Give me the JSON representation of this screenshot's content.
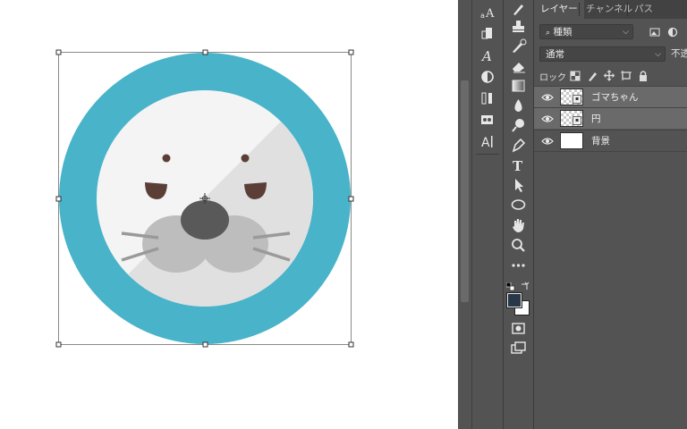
{
  "panel_tabs": [
    "レイヤー",
    "チャンネル",
    "パス"
  ],
  "filter": {
    "label": "種類"
  },
  "blend_mode": {
    "value": "通常"
  },
  "opacity": {
    "label": "不透"
  },
  "lock": {
    "label": "ロック :"
  },
  "layers": [
    {
      "name": "ゴマちゃん",
      "selected": true,
      "thumb": "transparent",
      "smart_object": true
    },
    {
      "name": "円",
      "selected": true,
      "thumb": "transparent",
      "smart_object": true
    },
    {
      "name": "背景",
      "selected": false,
      "thumb": "white",
      "smart_object": false
    }
  ],
  "colors": {
    "ring": "#48b3c9",
    "face": "#f4f4f4",
    "face_shadow": "#e0e0e0",
    "muzzle": "#bdbdbd",
    "nose": "#595959",
    "eyes": "#5b3f37",
    "whisker": "#9a9a9a",
    "foreground": "#283848",
    "background_swatch": "#ffffff"
  },
  "icons": {
    "secondary_panel": [
      "character-style-icon",
      "paragraph-icon",
      "character-icon",
      "adjustments-icon",
      "history-icon",
      "3d-icon",
      "glyphs-icon"
    ],
    "tools": [
      "brush-icon",
      "stamp-icon",
      "history-brush-icon",
      "eraser-icon",
      "gradient-icon",
      "blur-icon",
      "dodge-icon",
      "pen-icon",
      "type-icon",
      "path-select-icon",
      "ellipse-icon",
      "hand-icon",
      "zoom-icon",
      "more-tools-icon"
    ]
  }
}
